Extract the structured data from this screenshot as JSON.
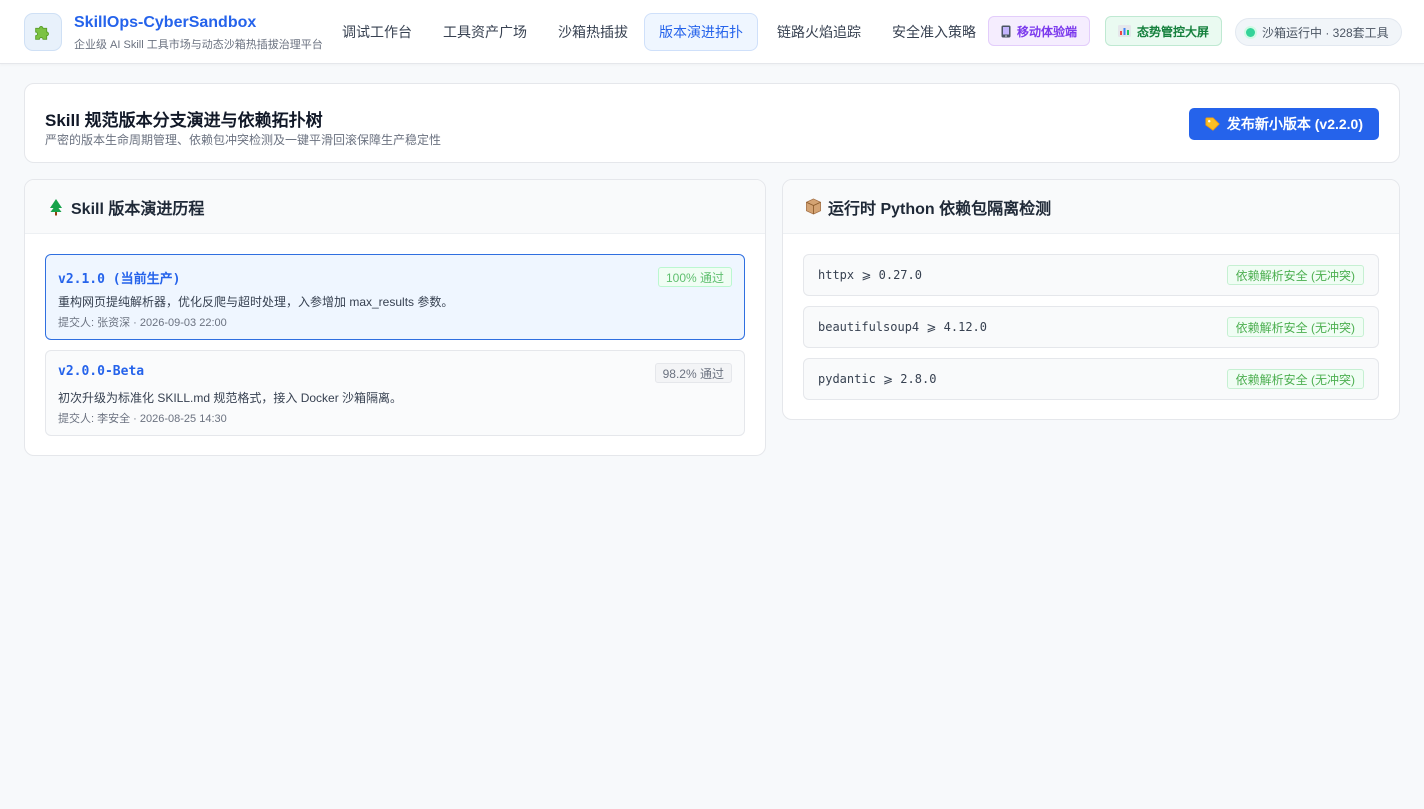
{
  "app": {
    "title": "SkillOps-CyberSandbox",
    "subtitle": "企业级 AI Skill 工具市场与动态沙箱热插拔治理平台"
  },
  "nav": {
    "tabs": [
      {
        "label": "调试工作台",
        "active": false
      },
      {
        "label": "工具资产广场",
        "active": false
      },
      {
        "label": "沙箱热插拔",
        "active": false
      },
      {
        "label": "版本演进拓扑",
        "active": true
      },
      {
        "label": "链路火焰追踪",
        "active": false
      },
      {
        "label": "安全准入策略",
        "active": false
      }
    ],
    "mobile_label": "移动体验端",
    "screen_label": "态势管控大屏",
    "status_label": "沙箱运行中 · 328套工具"
  },
  "page": {
    "title": "Skill 规范版本分支演进与依赖拓扑树",
    "subtitle": "严密的版本生命周期管理、依赖包冲突检测及一键平滑回滚保障生产稳定性",
    "publish_label": "发布新小版本 (v2.2.0)"
  },
  "versions_panel": {
    "title": "Skill 版本演进历程",
    "items": [
      {
        "name": "v2.1.0 (当前生产)",
        "badge": "100% 通过",
        "description": "重构网页提纯解析器，优化反爬与超时处理，入参增加 max_results 参数。",
        "meta": "提交人: 张资深 · 2026-09-03 22:00"
      },
      {
        "name": "v2.0.0-Beta",
        "badge": "98.2% 通过",
        "description": "初次升级为标准化 SKILL.md 规范格式，接入 Docker 沙箱隔离。",
        "meta": "提交人: 李安全 · 2026-08-25 14:30"
      }
    ]
  },
  "deps_panel": {
    "title": "运行时 Python 依赖包隔离检测",
    "items": [
      {
        "name": "httpx ⩾ 0.27.0",
        "status": "依赖解析安全 (无冲突)"
      },
      {
        "name": "beautifulsoup4 ⩾ 4.12.0",
        "status": "依赖解析安全 (无冲突)"
      },
      {
        "name": "pydantic ⩾ 2.8.0",
        "status": "依赖解析安全 (无冲突)"
      }
    ]
  },
  "colors": {
    "accent": "#2563eb",
    "success": "#4caf50",
    "mobile": "#7c3aed",
    "screen": "#15803d"
  },
  "icons": {
    "brand": "puzzle-icon",
    "mobile": "phone-icon",
    "screen": "bar-chart-icon",
    "publish": "tag-icon",
    "versions": "tree-icon",
    "deps": "package-icon"
  }
}
